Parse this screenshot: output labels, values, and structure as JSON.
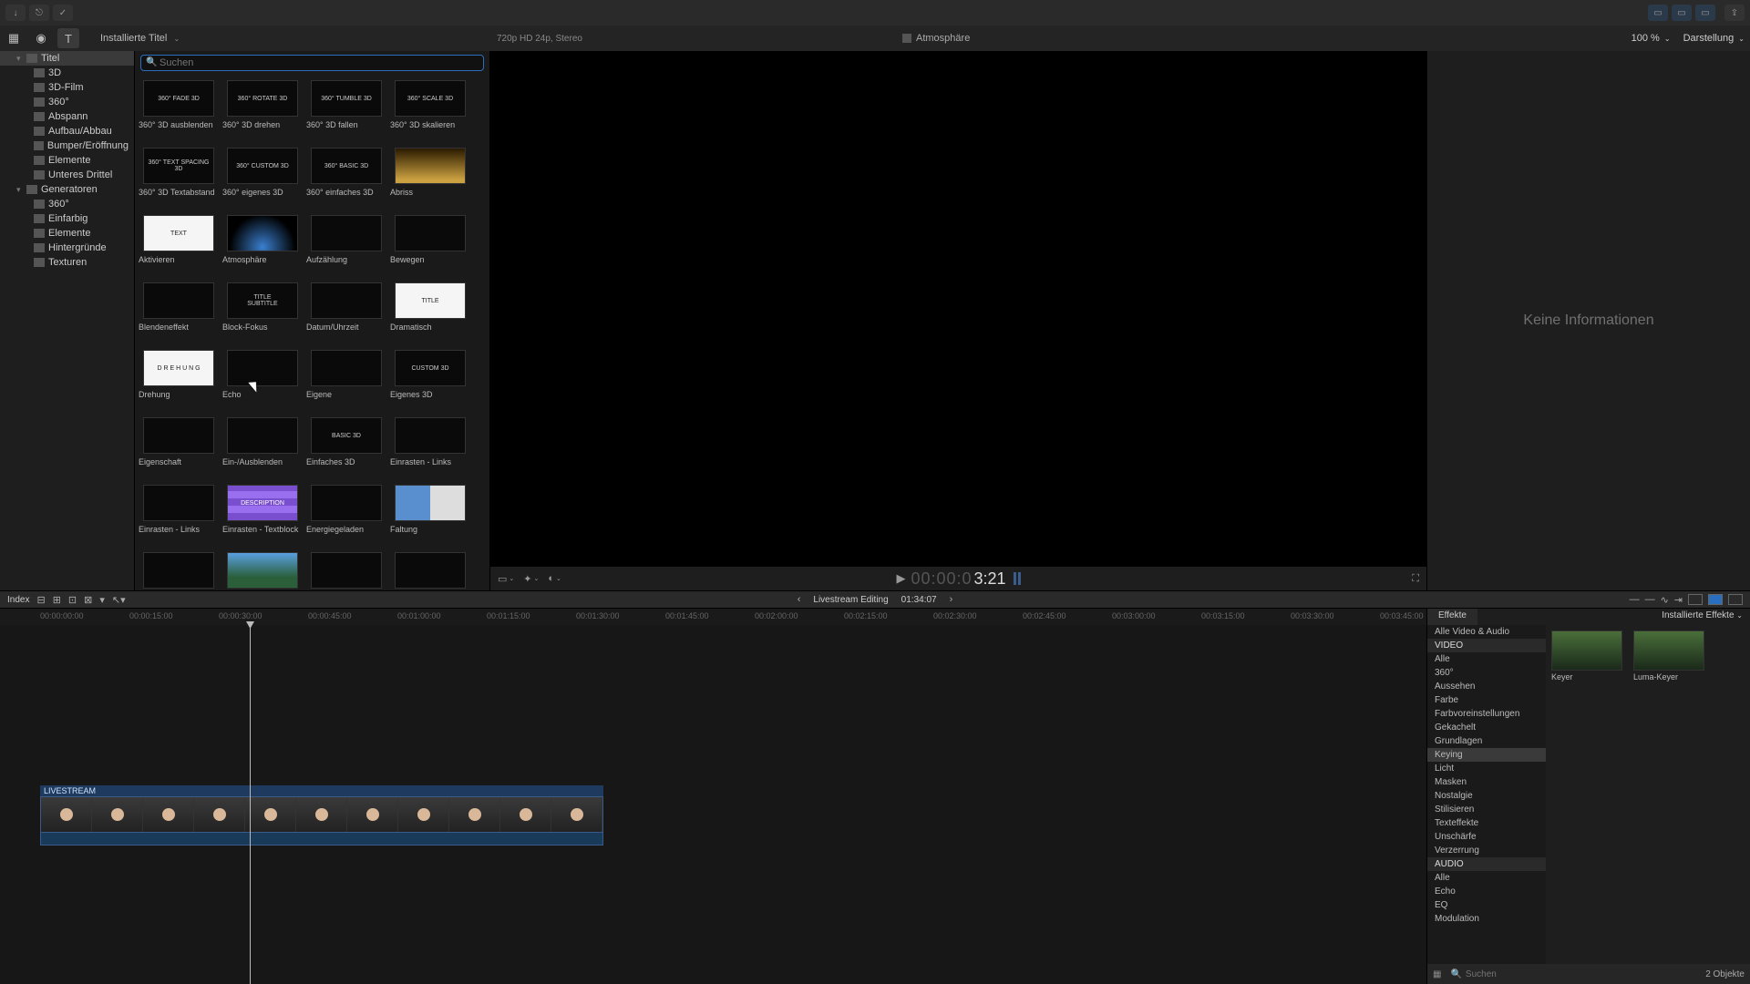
{
  "titlebar": {
    "back_icon": "‹",
    "fwd_icon": "›",
    "import_icon": "↓",
    "tool_icon": "⎋",
    "check_icon": "✓"
  },
  "toolrow": {
    "library_icon": "▦",
    "photos_icon": "◉",
    "titles_icon": "T",
    "breadcrumb": "Installierte Titel",
    "viewer_status": "720p HD 24p, Stereo",
    "viewer_clip": "Atmosphäre",
    "zoom_label": "100 %",
    "view_label": "Darstellung"
  },
  "sidebar": {
    "items": [
      {
        "label": "Titel",
        "lvl": 0,
        "disc": "▾",
        "active": true
      },
      {
        "label": "3D",
        "lvl": 1
      },
      {
        "label": "3D-Film",
        "lvl": 1
      },
      {
        "label": "360°",
        "lvl": 1
      },
      {
        "label": "Abspann",
        "lvl": 1
      },
      {
        "label": "Aufbau/Abbau",
        "lvl": 1
      },
      {
        "label": "Bumper/Eröffnung",
        "lvl": 1
      },
      {
        "label": "Elemente",
        "lvl": 1
      },
      {
        "label": "Unteres Drittel",
        "lvl": 1
      },
      {
        "label": "Generatoren",
        "lvl": 0,
        "disc": "▾"
      },
      {
        "label": "360°",
        "lvl": 1
      },
      {
        "label": "Einfarbig",
        "lvl": 1
      },
      {
        "label": "Elemente",
        "lvl": 1
      },
      {
        "label": "Hintergründe",
        "lvl": 1
      },
      {
        "label": "Texturen",
        "lvl": 1
      }
    ]
  },
  "browser": {
    "search_placeholder": "Suchen",
    "thumbs": [
      {
        "label": "360° 3D ausblenden",
        "txt": "360° FADE 3D"
      },
      {
        "label": "360° 3D drehen",
        "txt": "360° ROTATE 3D"
      },
      {
        "label": "360° 3D fallen",
        "txt": "360° TUMBLE 3D"
      },
      {
        "label": "360° 3D skalieren",
        "txt": "360° SCALE 3D"
      },
      {
        "label": "360° 3D Textabstand",
        "txt": "360° TEXT SPACING 3D"
      },
      {
        "label": "360° eigenes 3D",
        "txt": "360° CUSTOM 3D"
      },
      {
        "label": "360° einfaches 3D",
        "txt": "360° BASIC 3D"
      },
      {
        "label": "Abriss",
        "cls": "gold"
      },
      {
        "label": "Aktivieren",
        "txt": "TEXT",
        "cls": "white"
      },
      {
        "label": "Atmosphäre",
        "cls": "blue"
      },
      {
        "label": "Aufzählung"
      },
      {
        "label": "Bewegen"
      },
      {
        "label": "Blendeneffekt"
      },
      {
        "label": "Block-Fokus",
        "txt": "TITLE\\nSUBTITLE"
      },
      {
        "label": "Datum/Uhrzeit"
      },
      {
        "label": "Dramatisch",
        "txt": "TITLE",
        "cls": "white"
      },
      {
        "label": "Drehung",
        "cls": "white",
        "txt": "D R E H U N G"
      },
      {
        "label": "Echo"
      },
      {
        "label": "Eigene"
      },
      {
        "label": "Eigenes 3D",
        "txt": "CUSTOM 3D"
      },
      {
        "label": "Eigenschaft"
      },
      {
        "label": "Ein-/Ausblenden"
      },
      {
        "label": "Einfaches 3D",
        "txt": "BASIC 3D"
      },
      {
        "label": "Einrasten - Links"
      },
      {
        "label": "Einrasten - Links"
      },
      {
        "label": "Einrasten - Textblock",
        "cls": "purple",
        "txt": "DESCRIPTION"
      },
      {
        "label": "Energiegeladen"
      },
      {
        "label": "Faltung",
        "cls": "fold"
      },
      {
        "label": ""
      },
      {
        "label": "",
        "cls": "sky"
      },
      {
        "label": ""
      },
      {
        "label": ""
      }
    ]
  },
  "viewer": {
    "timecode_dim": "00:00:0",
    "timecode_bright": "3:21"
  },
  "inspector": {
    "empty": "Keine Informationen"
  },
  "btoolbar": {
    "index": "Index",
    "project": "Livestream Editing",
    "duration": "01:34:07"
  },
  "ruler_ticks": [
    "00:00:00:00",
    "00:00:15:00",
    "00:00:30:00",
    "00:00:45:00",
    "00:01:00:00",
    "00:01:15:00",
    "00:01:30:00",
    "00:01:45:00",
    "00:02:00:00",
    "00:02:15:00",
    "00:02:30:00",
    "00:02:45:00",
    "00:03:00:00",
    "00:03:15:00",
    "00:03:30:00",
    "00:03:45:00"
  ],
  "clip": {
    "title": "LIVESTREAM"
  },
  "effects": {
    "tab_effects": "Effekte",
    "tab_installed": "Installierte Effekte",
    "categories": [
      {
        "label": "Alle Video & Audio"
      },
      {
        "label": "VIDEO",
        "hdr": true
      },
      {
        "label": "Alle"
      },
      {
        "label": "360°"
      },
      {
        "label": "Aussehen"
      },
      {
        "label": "Farbe"
      },
      {
        "label": "Farbvoreinstellungen"
      },
      {
        "label": "Gekachelt"
      },
      {
        "label": "Grundlagen"
      },
      {
        "label": "Keying",
        "sel": true
      },
      {
        "label": "Licht"
      },
      {
        "label": "Masken"
      },
      {
        "label": "Nostalgie"
      },
      {
        "label": "Stilisieren"
      },
      {
        "label": "Texteffekte"
      },
      {
        "label": "Unschärfe"
      },
      {
        "label": "Verzerrung"
      },
      {
        "label": "AUDIO",
        "hdr": true
      },
      {
        "label": "Alle"
      },
      {
        "label": "Echo"
      },
      {
        "label": "EQ"
      },
      {
        "label": "Modulation"
      }
    ],
    "thumbs": [
      {
        "label": "Keyer"
      },
      {
        "label": "Luma-Keyer"
      }
    ],
    "search_placeholder": "Suchen",
    "count_label": "2 Objekte"
  }
}
